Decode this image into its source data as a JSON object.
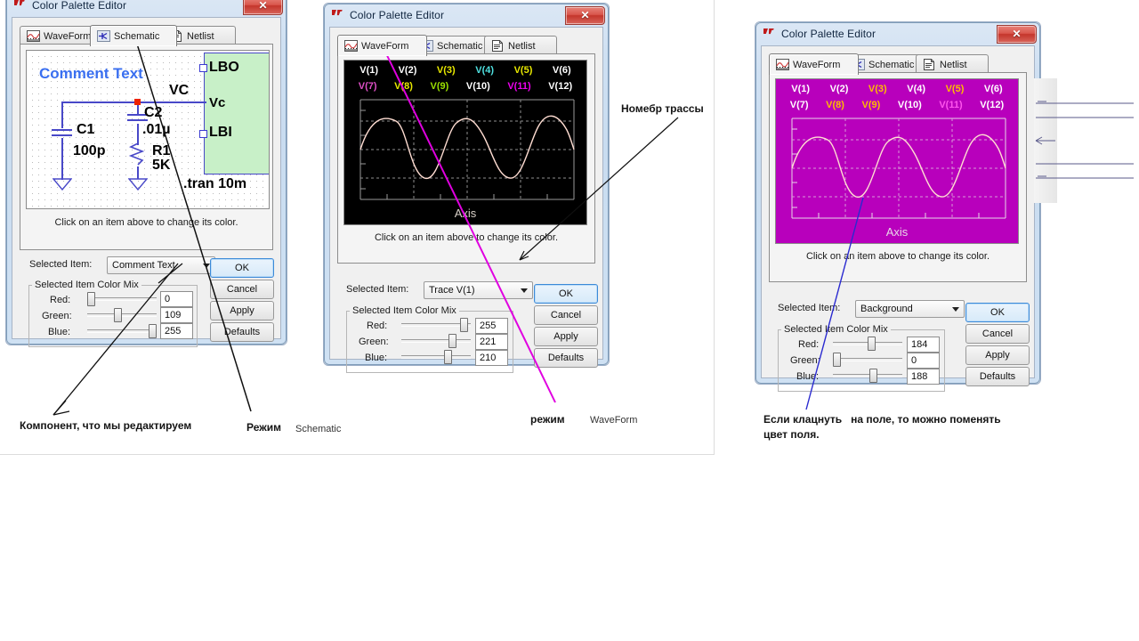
{
  "dialogs": [
    {
      "title": "Color Palette Editor",
      "close_label": "✕",
      "tabs": [
        {
          "label": "WaveForm",
          "icon": "waveform-icon",
          "selected": false
        },
        {
          "label": "Schematic",
          "icon": "schematic-icon",
          "selected": true
        },
        {
          "label": "Netlist",
          "icon": "netlist-icon",
          "selected": false
        }
      ],
      "hint": "Click on an item above to change its color.",
      "selected_item_label": "Selected Item:",
      "selected_item_value": "Comment Text",
      "group_caption": "Selected Item Color Mix",
      "channels": [
        {
          "label": "Red:",
          "value": "0",
          "pos": 0
        },
        {
          "label": "Green:",
          "value": "109",
          "pos": 43
        },
        {
          "label": "Blue:",
          "value": "255",
          "pos": 100
        }
      ],
      "buttons": [
        "OK",
        "Cancel",
        "Apply",
        "Defaults"
      ],
      "schematic": {
        "comment": "Comment Text",
        "comment_color": "#3a6ff0",
        "labels": [
          "VC",
          "Vc",
          "LBO",
          "LBI",
          "C1",
          "100p",
          "C2",
          ".01µ",
          "R1",
          "5K",
          ".tran 10m"
        ],
        "block_fill": "#c8f0c8",
        "wire_color": "#4848c8",
        "node_color": "#ee2200"
      }
    },
    {
      "title": "Color Palette Editor",
      "close_label": "✕",
      "tabs": [
        {
          "label": "WaveForm",
          "icon": "waveform-icon",
          "selected": true
        },
        {
          "label": "Schematic",
          "icon": "schematic-icon",
          "selected": false
        },
        {
          "label": "Netlist",
          "icon": "netlist-icon",
          "selected": false
        }
      ],
      "hint": "Click on an item above to change its color.",
      "selected_item_label": "Selected Item:",
      "selected_item_value": "Trace  V(1)",
      "group_caption": "Selected Item Color Mix",
      "channels": [
        {
          "label": "Red:",
          "value": "255",
          "pos": 88
        },
        {
          "label": "Green:",
          "value": "221",
          "pos": 72
        },
        {
          "label": "Blue:",
          "value": "210",
          "pos": 68
        }
      ],
      "buttons": [
        "OK",
        "Cancel",
        "Apply",
        "Defaults"
      ],
      "waveform": {
        "background": "#000000",
        "axis_label": "Axis",
        "axis_color": "#d8d0c8",
        "grid_color": "#9a9a9a",
        "trace_color": "#ffddd2",
        "traces": [
          {
            "label": "V(1)",
            "color": "#ffffff"
          },
          {
            "label": "V(2)",
            "color": "#ffffff"
          },
          {
            "label": "V(3)",
            "color": "#e8e800"
          },
          {
            "label": "V(4)",
            "color": "#4fe0e0"
          },
          {
            "label": "V(5)",
            "color": "#e8e800"
          },
          {
            "label": "V(6)",
            "color": "#ffffff"
          },
          {
            "label": "V(7)",
            "color": "#e050c8"
          },
          {
            "label": "V(8)",
            "color": "#e8e800"
          },
          {
            "label": "V(9)",
            "color": "#9ae000"
          },
          {
            "label": "V(10)",
            "color": "#ffffff"
          },
          {
            "label": "V(11)",
            "color": "#ee00ee"
          },
          {
            "label": "V(12)",
            "color": "#ffffff"
          }
        ]
      }
    },
    {
      "title": "Color Palette Editor",
      "close_label": "✕",
      "tabs": [
        {
          "label": "WaveForm",
          "icon": "waveform-icon",
          "selected": true
        },
        {
          "label": "Schematic",
          "icon": "schematic-icon",
          "selected": false
        },
        {
          "label": "Netlist",
          "icon": "netlist-icon",
          "selected": false
        }
      ],
      "hint": "Click on an item above to change its color.",
      "selected_item_label": "Selected Item:",
      "selected_item_value": "Background",
      "group_caption": "Selected Item Color Mix",
      "channels": [
        {
          "label": "Red:",
          "value": "184",
          "pos": 55
        },
        {
          "label": "Green:",
          "value": "0",
          "pos": 0
        },
        {
          "label": "Blue:",
          "value": "188",
          "pos": 57
        }
      ],
      "buttons": [
        "OK",
        "Cancel",
        "Apply",
        "Defaults"
      ],
      "waveform": {
        "background": "#b800bc",
        "axis_label": "Axis",
        "axis_color": "#e8d8e8",
        "grid_color": "#d89ad8",
        "trace_color": "#ffddd2",
        "traces": [
          {
            "label": "V(1)",
            "color": "#ffffff"
          },
          {
            "label": "V(2)",
            "color": "#ffffff"
          },
          {
            "label": "V(3)",
            "color": "#ffbb00"
          },
          {
            "label": "V(4)",
            "color": "#ffffff"
          },
          {
            "label": "V(5)",
            "color": "#ffbb00"
          },
          {
            "label": "V(6)",
            "color": "#ffffff"
          },
          {
            "label": "V(7)",
            "color": "#ffffff"
          },
          {
            "label": "V(8)",
            "color": "#ffbb00"
          },
          {
            "label": "V(9)",
            "color": "#ffbb00"
          },
          {
            "label": "V(10)",
            "color": "#ffffff"
          },
          {
            "label": "V(11)",
            "color": "#ff55ee"
          },
          {
            "label": "V(12)",
            "color": "#ffffff"
          }
        ]
      }
    }
  ],
  "annotations": {
    "component": "Компонент, что мы редактируем",
    "mode_bold": "Режим",
    "mode_value": "Schematic",
    "trace_number": "Номебр трассы",
    "mode2_bold": "режим",
    "mode2_value": "WaveForm",
    "field_note_line1": "Если клацнуть   на поле, то можно поменять",
    "field_note_line2": "цвет поля."
  }
}
